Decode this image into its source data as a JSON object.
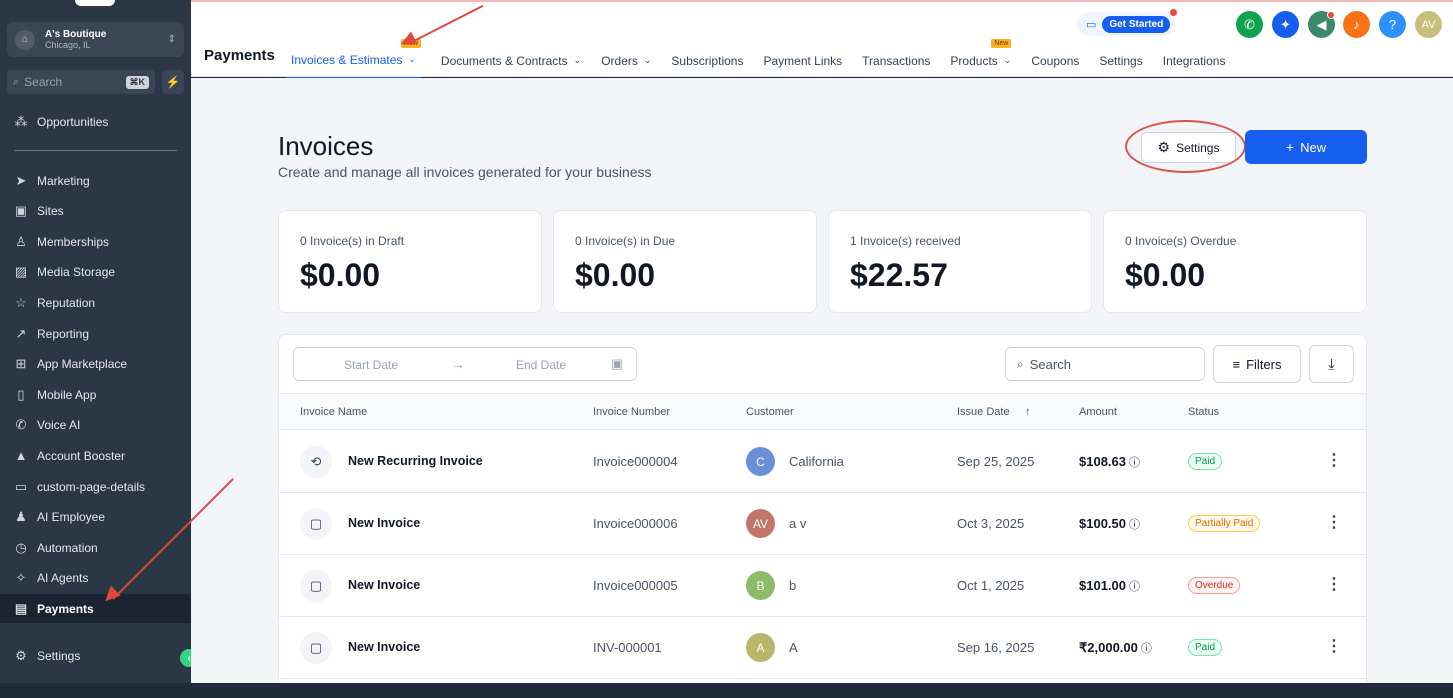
{
  "location": {
    "name": "A's Boutique",
    "city": "Chicago, IL"
  },
  "sidebar_search": {
    "placeholder": "Search",
    "shortcut": "⌘K"
  },
  "sidebar": {
    "top_item": {
      "label": "Opportunities",
      "icon": "opportunities-icon"
    },
    "items": [
      {
        "label": "Marketing",
        "icon": "send-icon"
      },
      {
        "label": "Sites",
        "icon": "sites-icon"
      },
      {
        "label": "Memberships",
        "icon": "membership-icon"
      },
      {
        "label": "Media Storage",
        "icon": "image-icon"
      },
      {
        "label": "Reputation",
        "icon": "star-icon"
      },
      {
        "label": "Reporting",
        "icon": "trend-icon"
      },
      {
        "label": "App Marketplace",
        "icon": "grid-icon"
      },
      {
        "label": "Mobile App",
        "icon": "mobile-icon"
      },
      {
        "label": "Voice AI",
        "icon": "phone-icon"
      },
      {
        "label": "Account Booster",
        "icon": "booster-icon"
      },
      {
        "label": "custom-page-details",
        "icon": "page-icon"
      },
      {
        "label": "AI Employee",
        "icon": "person-icon"
      },
      {
        "label": "Automation",
        "icon": "automation-icon"
      },
      {
        "label": "AI Agents",
        "icon": "sparkle-icon"
      },
      {
        "label": "Payments",
        "icon": "payments-icon",
        "active": true
      }
    ],
    "settings": "Settings"
  },
  "header": {
    "section": "Payments",
    "tabs": [
      {
        "label": "Invoices & Estimates",
        "dropdown": true,
        "active": true,
        "badge": "New"
      },
      {
        "label": "Documents & Contracts",
        "dropdown": true
      },
      {
        "label": "Orders",
        "dropdown": true
      },
      {
        "label": "Subscriptions"
      },
      {
        "label": "Payment Links"
      },
      {
        "label": "Transactions"
      },
      {
        "label": "Products",
        "dropdown": true,
        "badge": "New"
      },
      {
        "label": "Coupons"
      },
      {
        "label": "Settings"
      },
      {
        "label": "Integrations"
      }
    ],
    "get_started": "Get Started",
    "avatar_initials": "AV"
  },
  "page": {
    "title": "Invoices",
    "subtitle": "Create and manage all invoices generated for your business",
    "settings_button": "Settings",
    "new_button": "New"
  },
  "summary_cards": [
    {
      "label": "0 Invoice(s) in Draft",
      "amount": "$0.00"
    },
    {
      "label": "0 Invoice(s) in Due",
      "amount": "$0.00"
    },
    {
      "label": "1 Invoice(s) received",
      "amount": "$22.57"
    },
    {
      "label": "0 Invoice(s) Overdue",
      "amount": "$0.00"
    }
  ],
  "filters": {
    "start_date": "Start Date",
    "end_date": "End Date",
    "search_placeholder": "Search",
    "filters_button": "Filters"
  },
  "table": {
    "columns": [
      "Invoice Name",
      "Invoice Number",
      "Customer",
      "Issue Date",
      "Amount",
      "Status"
    ],
    "rows": [
      {
        "icon": "recurring-icon",
        "name": "New Recurring Invoice",
        "number": "Invoice000004",
        "avatar": "C",
        "avatar_color": "#6b8fd6",
        "customer": "California",
        "date": "Sep 25, 2025",
        "amount": "$108.63",
        "status": "Paid",
        "status_kind": "paid"
      },
      {
        "icon": "invoice-icon",
        "name": "New Invoice",
        "number": "Invoice000006",
        "avatar": "AV",
        "avatar_color": "#c0776a",
        "customer": "a v",
        "date": "Oct 3, 2025",
        "amount": "$100.50",
        "status": "Partially Paid",
        "status_kind": "partial"
      },
      {
        "icon": "invoice-icon",
        "name": "New Invoice",
        "number": "Invoice000005",
        "avatar": "B",
        "avatar_color": "#8dbb6a",
        "customer": "b",
        "date": "Oct 1, 2025",
        "amount": "$101.00",
        "status": "Overdue",
        "status_kind": "overdue"
      },
      {
        "icon": "invoice-icon",
        "name": "New Invoice",
        "number": "INV-000001",
        "avatar": "A",
        "avatar_color": "#b9b56a",
        "customer": "A",
        "date": "Sep 16, 2025",
        "amount": "₹2,000.00",
        "status": "Paid",
        "status_kind": "paid"
      }
    ]
  },
  "colors": {
    "primary": "#155eef",
    "sidebar_bg": "#2b3646",
    "annotation": "#e0483e",
    "paid": "#12b76a",
    "partial": "#f79009",
    "overdue": "#f04438"
  }
}
